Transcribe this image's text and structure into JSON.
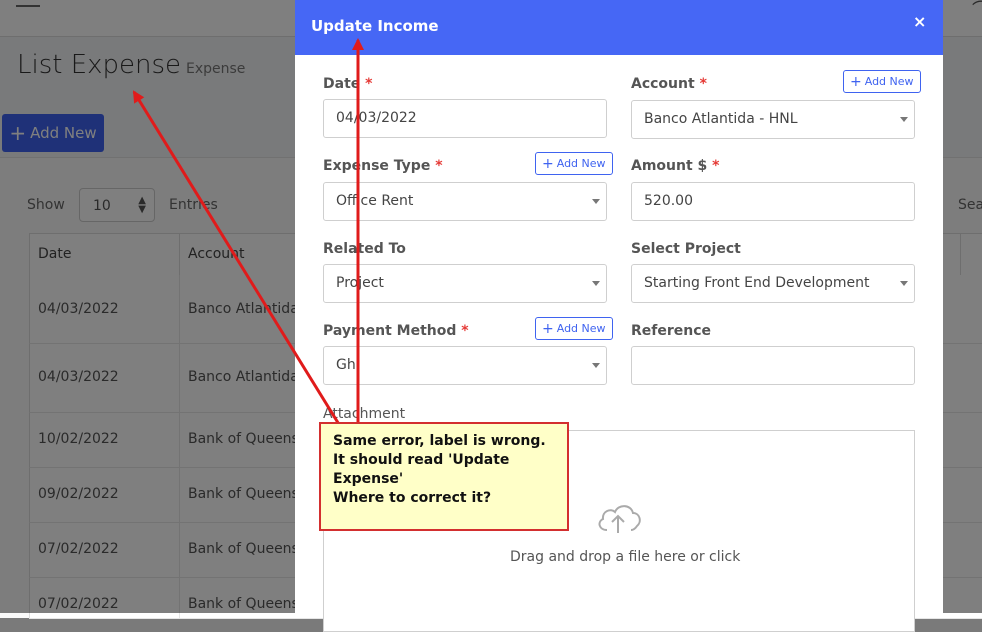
{
  "page": {
    "title": "List Expense",
    "breadcrumb": "Expense",
    "add_button": "Add New",
    "show_label": "Show",
    "show_value": "10",
    "entries_label": "Entries",
    "search_label": "Sea",
    "table": {
      "columns": [
        "Date",
        "Account"
      ],
      "rows": [
        {
          "date": "04/03/2022",
          "account": "Banco Atlantida"
        },
        {
          "date": "04/03/2022",
          "account": "Banco Atlantida"
        },
        {
          "date": "10/02/2022",
          "account": "Bank of Queens"
        },
        {
          "date": "09/02/2022",
          "account": "Bank of Queens"
        },
        {
          "date": "07/02/2022",
          "account": "Bank of Queens"
        },
        {
          "date": "07/02/2022",
          "account": "Bank of Queens"
        }
      ]
    }
  },
  "modal": {
    "title": "Update Income",
    "close": "×",
    "add_new": "Add New",
    "required_mark": "*",
    "date": {
      "label": "Date",
      "value": "04/03/2022"
    },
    "account": {
      "label": "Account",
      "value": "Banco Atlantida - HNL"
    },
    "expense_type": {
      "label": "Expense Type",
      "value": "Office Rent"
    },
    "amount": {
      "label": "Amount $",
      "value": "520.00"
    },
    "related_to": {
      "label": "Related To",
      "value": "Project"
    },
    "select_project": {
      "label": "Select Project",
      "value": "Starting Front End Development"
    },
    "payment_method": {
      "label": "Payment Method",
      "value": "Gh"
    },
    "reference": {
      "label": "Reference",
      "value": ""
    },
    "attachment": {
      "label": "Attachment",
      "dropzone_text": "Drag and drop a file here or click"
    }
  },
  "callout": {
    "text": "Same error, label is wrong.\nIt should read 'Update Expense'\nWhere to correct it?"
  },
  "colors": {
    "modal_header": "#4667f5",
    "primary": "#3f63f0",
    "required": "#e53935",
    "callout_border": "#d32f2f",
    "callout_bg": "#ffffc8",
    "arrow": "#e01b1b"
  }
}
